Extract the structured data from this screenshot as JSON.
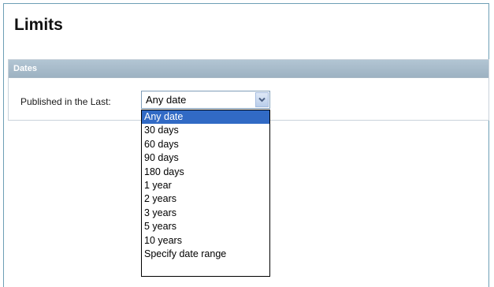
{
  "page": {
    "title": "Limits"
  },
  "dates_section": {
    "header": "Dates",
    "field_label": "Published in the Last:",
    "select": {
      "value": "Any date",
      "options": [
        "Any date",
        "30 days",
        "60 days",
        "90 days",
        "180 days",
        "1 year",
        "2 years",
        "3 years",
        "5 years",
        "10 years",
        "Specify date range"
      ],
      "selected_index": 0
    }
  },
  "icons": {
    "dropdown_arrow": "chevron-down-icon"
  },
  "colors": {
    "section_header_bg": "#a7bccb",
    "selected_option_bg": "#316ac5",
    "frame_border": "#6e9fb6"
  }
}
